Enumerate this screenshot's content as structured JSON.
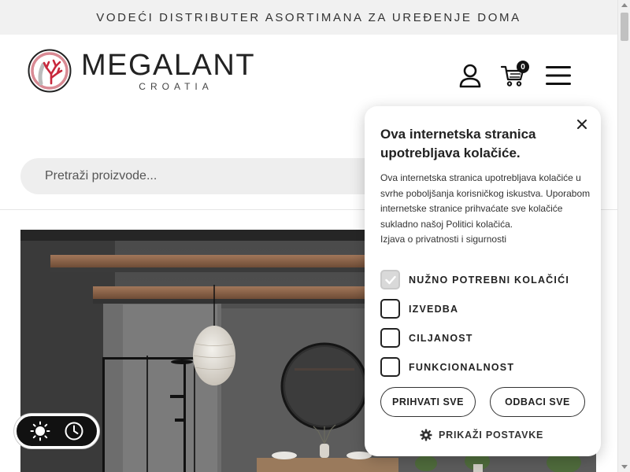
{
  "topbar": {
    "text": "VODEĆI DISTRIBUTER ASORTIMANA ZA UREĐENJE DOMA"
  },
  "logo": {
    "title": "MEGALANT",
    "subtitle": "CROATIA"
  },
  "header": {
    "account_icon": "user-icon",
    "cart_icon": "cart-icon",
    "cart_count": "0",
    "menu_icon": "hamburger-menu-icon"
  },
  "search": {
    "placeholder": "Pretraži proizvode..."
  },
  "cookie": {
    "title": "Ova internetska stranica upotrebljava kolačiće.",
    "body_1": "Ova internetska stranica upotrebljava kolačiće u svrhe poboljšanja korisničkog iskustva. Uporabom internetske stranice prihvaćate sve kolačiće sukladno našoj Politici kolačića.",
    "body_2": "Izjava o privatnosti i sigurnosti",
    "options": [
      {
        "label": "NUŽNO POTREBNI KOLAČIĆI",
        "checked": true
      },
      {
        "label": "IZVEDBA",
        "checked": false
      },
      {
        "label": "CILJANOST",
        "checked": false
      },
      {
        "label": "FUNKCIONALNOST",
        "checked": false
      }
    ],
    "accept_label": "PRIHVATI SVE",
    "reject_label": "ODBACI SVE",
    "settings_label": "PRIKAŽI POSTAVKE"
  },
  "theme_toggle": {
    "light_icon": "sun-icon",
    "auto_icon": "clock-icon"
  },
  "colors": {
    "topbar_bg": "#f1f1f1",
    "accent_red": "#c8283c",
    "dark": "#111111",
    "search_bg": "#eeeeee"
  }
}
